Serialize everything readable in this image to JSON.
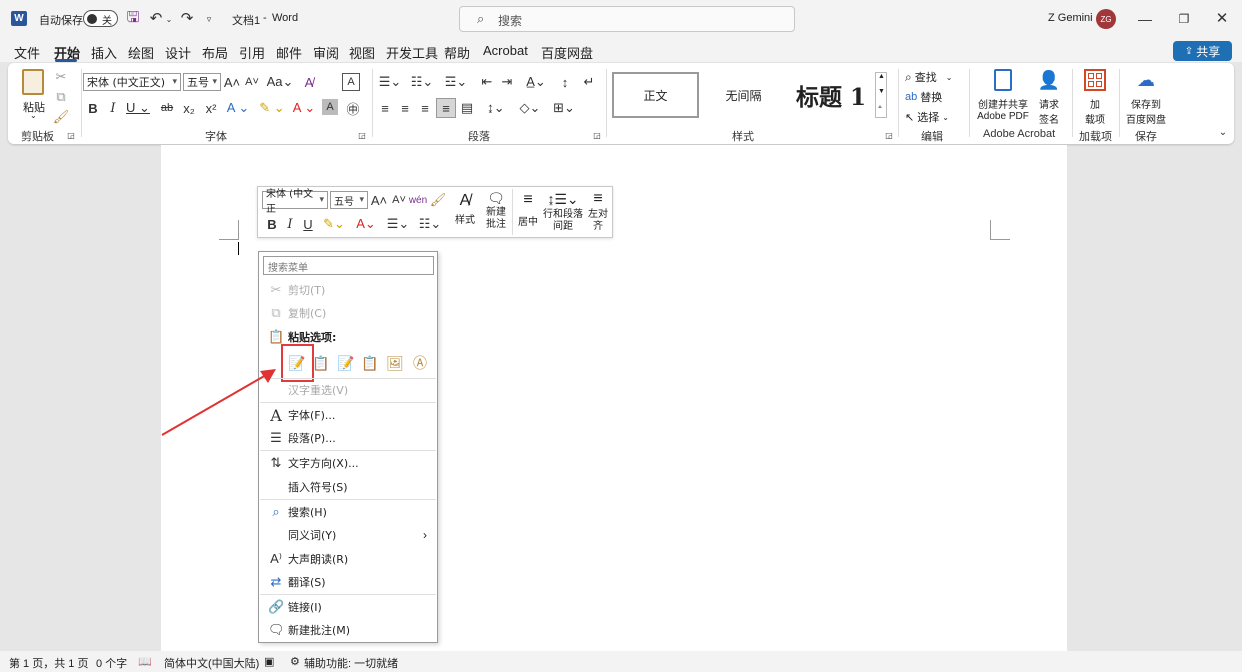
{
  "titlebar": {
    "autosave_label": "自动保存",
    "autosave_state": "关",
    "doc_title": "文档1",
    "title_sep": "-",
    "app_name": "Word",
    "search_placeholder": "搜索",
    "user_name": "Z Gemini",
    "user_initials": "ZG"
  },
  "tabs": [
    "文件",
    "开始",
    "插入",
    "绘图",
    "设计",
    "布局",
    "引用",
    "邮件",
    "审阅",
    "视图",
    "开发工具",
    "帮助",
    "Acrobat",
    "百度网盘"
  ],
  "active_tab": "开始",
  "share_label": "共享",
  "ribbon": {
    "paste_label": "粘贴",
    "clipboard_label": "剪贴板",
    "font_name": "宋体 (中文正文)",
    "font_size": "五号",
    "font_group_label": "字体",
    "paragraph_group_label": "段落",
    "styles_group_label": "样式",
    "styles": [
      "正文",
      "无间隔",
      "标题 1"
    ],
    "find_label": "查找",
    "replace_label": "替换",
    "select_label": "选择",
    "edit_group_label": "编辑",
    "acrobat_btn1": "创建并共享",
    "acrobat_btn2": "Adobe PDF",
    "request_sign1": "请求",
    "request_sign2": "签名",
    "acrobat_group_label": "Adobe Acrobat",
    "addins_btn1": "加",
    "addins_btn2": "载项",
    "addins_group_label": "加载项",
    "baidu_btn1": "保存到",
    "baidu_btn2": "百度网盘",
    "save_group_label": "保存"
  },
  "mini_toolbar": {
    "font_name": "宋体 (中文正",
    "font_size": "五号",
    "styles_label": "样式",
    "new_comment_1": "新建",
    "new_comment_2": "批注",
    "center_label": "居中",
    "line_spacing_1": "行和段落",
    "line_spacing_2": "间距",
    "align_left_1": "左对",
    "align_left_2": "齐"
  },
  "context_menu": {
    "search_placeholder": "搜索菜单",
    "cut": "剪切(T)",
    "copy": "复制(C)",
    "paste_options": "粘贴选项:",
    "hanzi_reselect": "汉字重选(V)",
    "font": "字体(F)...",
    "paragraph": "段落(P)...",
    "text_direction": "文字方向(X)...",
    "insert_symbol": "插入符号(S)",
    "search": "搜索(H)",
    "synonyms": "同义词(Y)",
    "read_aloud": "大声朗读(R)",
    "translate": "翻译(S)",
    "link": "链接(I)",
    "new_comment": "新建批注(M)"
  },
  "statusbar": {
    "page": "第 1 页，共 1 页",
    "words": "0 个字",
    "language": "简体中文(中国大陆)",
    "accessibility": "辅助功能: 一切就绪"
  },
  "colors": {
    "accent": "#2b579a",
    "share_bg": "#1f6fb5",
    "highlight_red": "#e23b3b",
    "arrow_red": "#e03232"
  }
}
